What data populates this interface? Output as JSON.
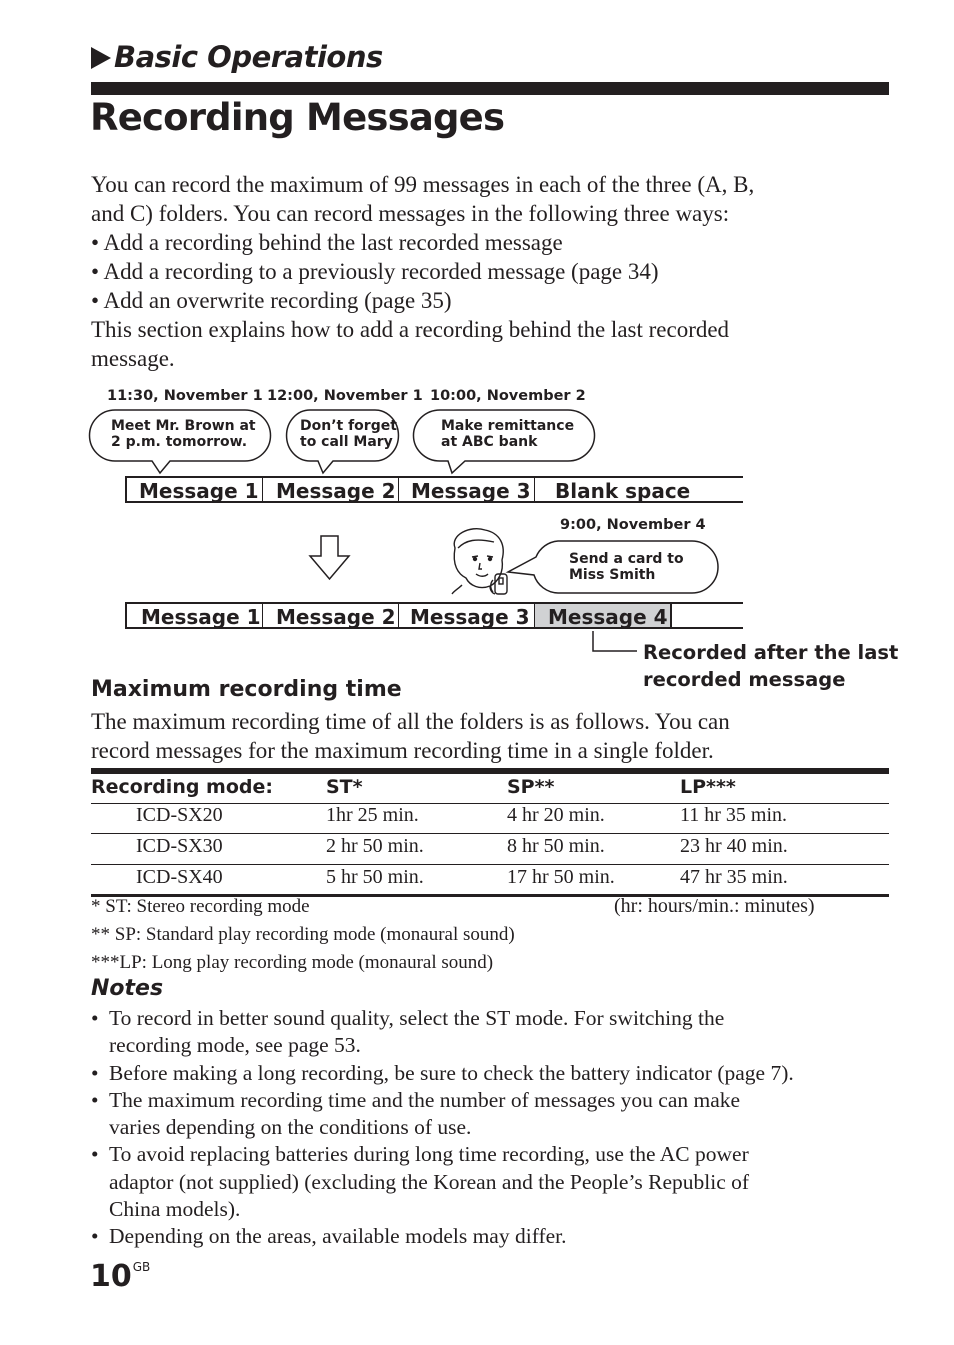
{
  "header": {
    "section_label": "Basic Operations",
    "page_title": "Recording Messages"
  },
  "intro": {
    "lines": [
      "You can record the maximum of 99 messages in each of the three (A, B,",
      "and C) folders.  You can record messages in the following three ways:",
      "• Add a recording behind the last recorded message",
      "• Add a recording to a previously recorded message (page 34)",
      "• Add an overwrite recording  (page 35)",
      "This section explains how to add a recording behind the last recorded",
      "message."
    ]
  },
  "diagram": {
    "timestamps": [
      "11:30,  November 1",
      "12:00,  November 1",
      "10:00,  November 2"
    ],
    "bubbles": [
      [
        "Meet Mr. Brown at",
        "2 p.m. tomorrow."
      ],
      [
        "Don’t forget",
        "to call Mary"
      ],
      [
        "Make remittance",
        "at ABC bank"
      ]
    ],
    "before_row": [
      "Message 1",
      "Message 2",
      "Message 3",
      "Blank space"
    ],
    "new_timestamp": "9:00, November 4",
    "new_bubble": [
      "Send a card to",
      "Miss Smith"
    ],
    "after_row": [
      "Message 1",
      "Message 2",
      "Message 3",
      "Message 4"
    ],
    "callout": [
      "Recorded after the last",
      "recorded message"
    ],
    "highlight_color": "#d1d2d4"
  },
  "max_time": {
    "heading": "Maximum recording time",
    "lines": [
      "The maximum recording time of all the folders is as follows.  You can",
      "record messages for the maximum recording time in a single folder."
    ]
  },
  "table": {
    "headers": [
      "Recording mode:",
      "ST*",
      "SP**",
      "LP***"
    ],
    "rows": [
      [
        "ICD-SX20",
        "1hr 25 min.",
        "4 hr 20 min.",
        "11 hr 35 min."
      ],
      [
        "ICD-SX30",
        "2 hr 50 min.",
        "8 hr 50 min.",
        "23 hr 40 min."
      ],
      [
        "ICD-SX40",
        "5 hr 50 min.",
        "17 hr 50 min.",
        "47 hr 35 min."
      ]
    ]
  },
  "footnotes": {
    "st": "* ST: Stereo recording mode",
    "units": "(hr:  hours/min.: minutes)",
    "sp": "** SP: Standard play recording mode (monaural sound)",
    "lp": "***LP: Long play recording mode (monaural sound)"
  },
  "notes": {
    "heading": "Notes",
    "items": [
      [
        "To record in better sound quality, select the ST mode.  For switching the",
        "recording mode, see page 53."
      ],
      [
        "Before making a long recording, be sure to check the battery indicator (page 7)."
      ],
      [
        "The maximum recording time and the number of messages you can make",
        "varies depending on the conditions of use."
      ],
      [
        "To avoid replacing batteries during long time recording, use the AC power",
        "adaptor (not supplied) (excluding the Korean and the People’s Republic of",
        "China models)."
      ],
      [
        "Depending on the areas, available models may differ."
      ]
    ]
  },
  "footer": {
    "page_number": "10",
    "page_suffix": "GB"
  }
}
